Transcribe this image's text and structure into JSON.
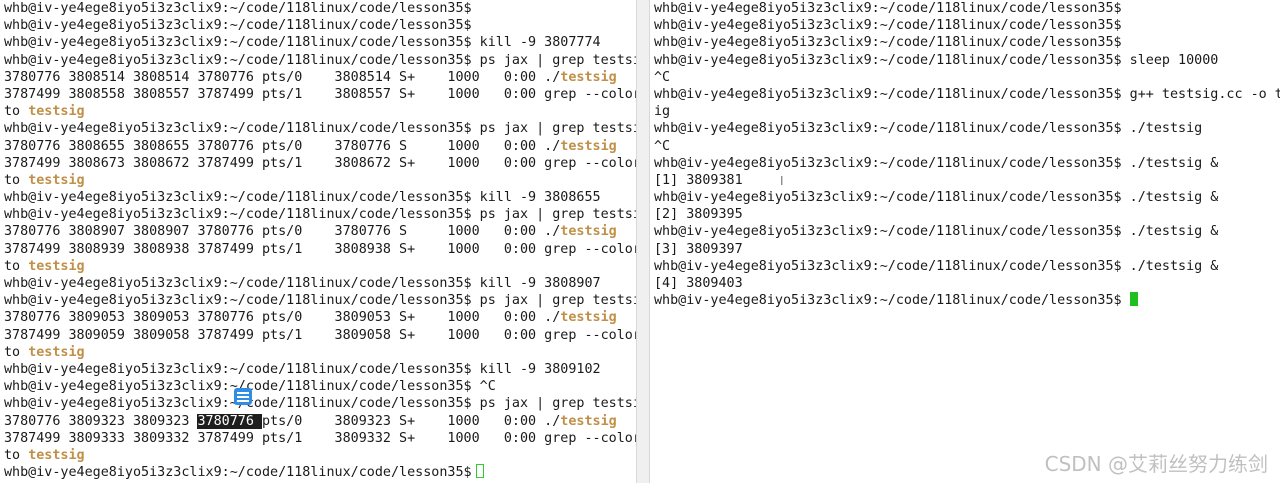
{
  "left_terminal": {
    "lines": [
      {
        "t": "whb@iv-ye4ege8iyo5i3z3clix9:~/code/118linux/code/lesson35$"
      },
      {
        "t": "whb@iv-ye4ege8iyo5i3z3clix9:~/code/118linux/code/lesson35$"
      },
      {
        "t": "whb@iv-ye4ege8iyo5i3z3clix9:~/code/118linux/code/lesson35$ kill -9 3807774"
      },
      {
        "t": "whb@iv-ye4ege8iyo5i3z3clix9:~/code/118linux/code/lesson35$ ps jax | grep testsig"
      },
      {
        "t": "3780776 3808514 3808514 3780776 pts/0    3808514 S+    1000   0:00 ./",
        "h": "testsig"
      },
      {
        "t": "3787499 3808558 3808557 3787499 pts/1    3808557 S+    1000   0:00 grep --color=au"
      },
      {
        "t": "to ",
        "h": "testsig"
      },
      {
        "t": "whb@iv-ye4ege8iyo5i3z3clix9:~/code/118linux/code/lesson35$ ps jax | grep testsig"
      },
      {
        "t": "3780776 3808655 3808655 3780776 pts/0    3780776 S     1000   0:00 ./",
        "h": "testsig"
      },
      {
        "t": "3787499 3808673 3808672 3787499 pts/1    3808672 S+    1000   0:00 grep --color=au"
      },
      {
        "t": "to ",
        "h": "testsig"
      },
      {
        "t": "whb@iv-ye4ege8iyo5i3z3clix9:~/code/118linux/code/lesson35$ kill -9 3808655"
      },
      {
        "t": "whb@iv-ye4ege8iyo5i3z3clix9:~/code/118linux/code/lesson35$ ps jax | grep testsig"
      },
      {
        "t": "3780776 3808907 3808907 3780776 pts/0    3780776 S     1000   0:00 ./",
        "h": "testsig"
      },
      {
        "t": "3787499 3808939 3808938 3787499 pts/1    3808938 S+    1000   0:00 grep --color=au"
      },
      {
        "t": "to ",
        "h": "testsig"
      },
      {
        "t": "whb@iv-ye4ege8iyo5i3z3clix9:~/code/118linux/code/lesson35$ kill -9 3808907"
      },
      {
        "t": "whb@iv-ye4ege8iyo5i3z3clix9:~/code/118linux/code/lesson35$ ps jax | grep testsig"
      },
      {
        "t": "3780776 3809053 3809053 3780776 pts/0    3809053 S+    1000   0:00 ./",
        "h": "testsig"
      },
      {
        "t": "3787499 3809059 3809058 3787499 pts/1    3809058 S+    1000   0:00 grep --color=au"
      },
      {
        "t": "to ",
        "h": "testsig"
      },
      {
        "t": "whb@iv-ye4ege8iyo5i3z3clix9:~/code/118linux/code/lesson35$ kill -9 3809102"
      },
      {
        "t": "whb@iv-ye4ege8iyo5i3z3clix9:~/code/118linux/code/lesson35$ ^C"
      },
      {
        "t": "whb@iv-ye4ege8iyo5i3z3clix9:~/code/118linux/code/lesson35$ ps jax | grep testsig"
      },
      {
        "t": "3780776 3809323 3809323 ",
        "sel": "3780776 ",
        "t2": "pts/0    3809323 S+    1000   0:00 ./",
        "h": "testsig"
      },
      {
        "t": "3787499 3809333 3809332 3787499 pts/1    3809332 S+    1000   0:00 grep --color=au"
      },
      {
        "t": "to ",
        "h": "testsig"
      },
      {
        "t": "whb@iv-ye4ege8iyo5i3z3clix9:~/code/118linux/code/lesson35$",
        "cursor": "hollow"
      }
    ]
  },
  "right_terminal": {
    "lines": [
      {
        "t": "whb@iv-ye4ege8iyo5i3z3clix9:~/code/118linux/code/lesson35$"
      },
      {
        "t": "whb@iv-ye4ege8iyo5i3z3clix9:~/code/118linux/code/lesson35$"
      },
      {
        "t": "whb@iv-ye4ege8iyo5i3z3clix9:~/code/118linux/code/lesson35$"
      },
      {
        "t": "whb@iv-ye4ege8iyo5i3z3clix9:~/code/118linux/code/lesson35$ sleep 10000"
      },
      {
        "t": "^C"
      },
      {
        "t": "whb@iv-ye4ege8iyo5i3z3clix9:~/code/118linux/code/lesson35$ g++ testsig.cc -o tests"
      },
      {
        "t": "ig"
      },
      {
        "t": "whb@iv-ye4ege8iyo5i3z3clix9:~/code/118linux/code/lesson35$ ./testsig"
      },
      {
        "t": "^C"
      },
      {
        "t": "whb@iv-ye4ege8iyo5i3z3clix9:~/code/118linux/code/lesson35$ ./testsig &"
      },
      {
        "t": "[1] 3809381"
      },
      {
        "t": "whb@iv-ye4ege8iyo5i3z3clix9:~/code/118linux/code/lesson35$ ./testsig &"
      },
      {
        "t": "[2] 3809395"
      },
      {
        "t": "whb@iv-ye4ege8iyo5i3z3clix9:~/code/118linux/code/lesson35$ ./testsig &"
      },
      {
        "t": "[3] 3809397"
      },
      {
        "t": "whb@iv-ye4ege8iyo5i3z3clix9:~/code/118linux/code/lesson35$ ./testsig &"
      },
      {
        "t": "[4] 3809403"
      },
      {
        "t": "whb@iv-ye4ege8iyo5i3z3clix9:~/code/118linux/code/lesson35$ ",
        "cursor": "block"
      }
    ]
  },
  "overlay": {
    "ibeam_glyph": "I",
    "watermark": "CSDN @艾莉丝努力练剑"
  },
  "colors": {
    "highlight": "#c09048",
    "cursor": "#1fbf1f",
    "selection_bg": "#1e1e1e"
  }
}
